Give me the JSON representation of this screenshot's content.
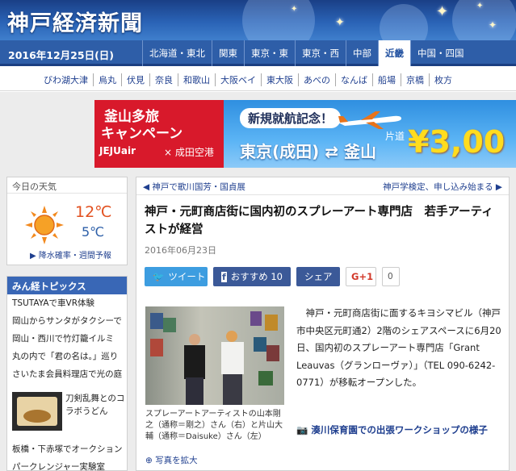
{
  "header": {
    "site_title": "神戸経済新聞",
    "date": "2016年12月25日(日)",
    "regions": [
      "北海道・東北",
      "関東",
      "東京・東",
      "東京・西",
      "中部",
      "近畿",
      "中国・四国"
    ],
    "active_region": "近畿",
    "cities": [
      "びわ湖大津",
      "烏丸",
      "伏見",
      "奈良",
      "和歌山",
      "大阪ベイ",
      "東大阪",
      "あべの",
      "なんば",
      "船場",
      "京橋",
      "枚方"
    ]
  },
  "banner": {
    "campaign_line1": "釜山多旅",
    "campaign_line2": "キャンペーン",
    "airline": "JEJUair",
    "airport": "× 成田空港",
    "new_route": "新規就航記念！",
    "route": "東京(成田) ⇄ 釜山",
    "fare_label": "片道",
    "price": "¥3,00"
  },
  "weather": {
    "heading": "今日の天気",
    "high": "12℃",
    "low": "5℃",
    "link": "降水確率・週間予報",
    "icon": "sun-icon",
    "sun_color": "#f2891e"
  },
  "topics": {
    "heading": "みん経トピックス",
    "items": [
      "TSUTAYAで車VR体験",
      "岡山からサンタがタクシーで",
      "岡山・西川で竹灯籠イルミ",
      "丸の内で「君の名は。」巡り",
      "さいたま会員料理店で光の庭"
    ],
    "image_item": "刀剣乱舞とのコラボうどん",
    "more_items": [
      "板橋・下赤塚でオークション",
      "パークレンジャー実験室"
    ]
  },
  "article": {
    "prev_link": "◀ 神戸で歌川国芳・国貞展",
    "next_link": "神戸学検定、申し込み始まる ▶",
    "title": "神戸・元町商店街に国内初のスプレーアート専門店　若手アーティストが経営",
    "date": "2016年06月23日",
    "share": {
      "tweet": "ツイート",
      "recommend": "おすすめ 10",
      "share": "シェア",
      "gplus": "G+1",
      "gplus_count": "0"
    },
    "photo_caption": "スプレーアートアーティストの山本剛之（通称＝剛之）さん（右）と片山大輔（通称＝Daisuke）さん（左）",
    "enlarge": "写真を拡大",
    "body": "　神戸・元町商店街に面するキヨシマビル（神戸市中央区元町通2）2階のシェアスペースに6月20日、国内初のスプレーアート専門店「Grant Leauvas（グランローヴァ）」（TEL 090-6242-0771）が移転オープンした。",
    "related": "湊川保育園での出張ワークショップの様子"
  },
  "colors": {
    "header_blue": "#1f4f9f",
    "tweet_blue": "#3d9de0",
    "facebook_blue": "#3b5998",
    "banner_red": "#d8192b",
    "price_yellow": "#ffdc1e"
  }
}
